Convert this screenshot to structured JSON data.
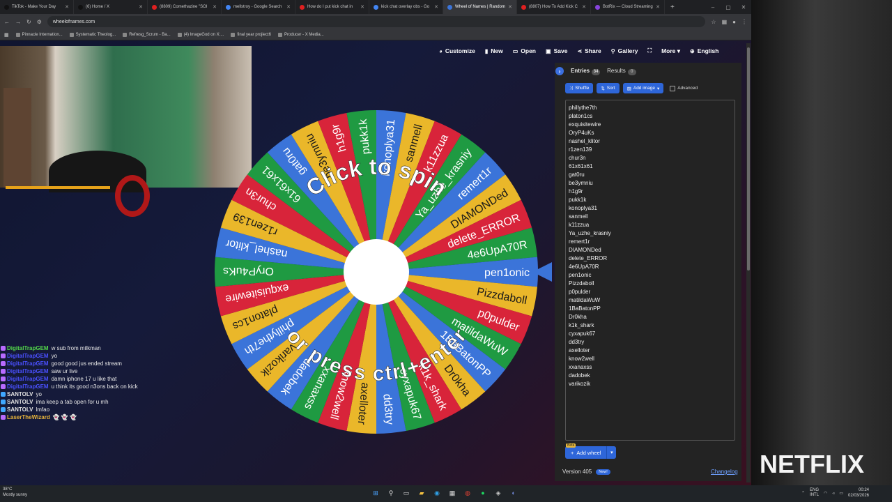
{
  "browser": {
    "tabs": [
      {
        "title": "TikTok - Make Your Day",
        "color": "#111111"
      },
      {
        "title": "(6) Home / X",
        "color": "#111111"
      },
      {
        "title": "(8809) Comethazine \"SOI",
        "color": "#e02020"
      },
      {
        "title": "mellstroy - Google Search",
        "color": "#4285f4"
      },
      {
        "title": "How do I put kick chat in",
        "color": "#e02020"
      },
      {
        "title": "kick chat overlay obs - Go",
        "color": "#4285f4"
      },
      {
        "title": "Wheel of Names | Random",
        "color": "#3b74d9",
        "active": true
      },
      {
        "title": "(8807) How To Add Kick C",
        "color": "#e02020"
      },
      {
        "title": "BotRix — Cloud Streaming",
        "color": "#8844dd"
      }
    ],
    "new_tab": "+",
    "url": "wheelofnames.com",
    "bookmarks": [
      "Pinnacle Internation...",
      "Systematic Theolog...",
      "Refresg_Scrum - Ba...",
      "(4) ImageGod on X:...",
      "final year projiect6",
      "Producer - X Media..."
    ]
  },
  "topnav": {
    "items": [
      {
        "icon": "palette-icon",
        "glyph": "◕",
        "label": "Customize"
      },
      {
        "icon": "new-file-icon",
        "glyph": "▮",
        "label": "New"
      },
      {
        "icon": "folder-icon",
        "glyph": "▭",
        "label": "Open"
      },
      {
        "icon": "save-icon",
        "glyph": "▣",
        "label": "Save"
      },
      {
        "icon": "share-icon",
        "glyph": "⋖",
        "label": "Share"
      },
      {
        "icon": "search-icon",
        "glyph": "⚲",
        "label": "Gallery"
      },
      {
        "icon": "fullscreen-icon",
        "glyph": "⛶",
        "label": ""
      },
      {
        "icon": "more-icon",
        "glyph": "",
        "label": "More ▾"
      },
      {
        "icon": "globe-icon",
        "glyph": "⊕",
        "label": "English"
      }
    ]
  },
  "wheel": {
    "center_top": "Click to spin",
    "center_bottom": "or press ctrl+enter",
    "colors": [
      "#3b74d9",
      "#eab72a",
      "#d8243a",
      "#1f9a42"
    ]
  },
  "panel": {
    "entries_tab": "Entries",
    "entries_count": "34",
    "results_tab": "Results",
    "results_count": "0",
    "shuffle": "Shuffle",
    "sort": "Sort",
    "add_image": "Add image",
    "advanced": "Advanced",
    "entries": [
      "phillythe7th",
      "platon1cs",
      "exquisitewire",
      "OryP4uKs",
      "nashel_klitor",
      "r1zen139",
      "chur3n",
      "61x61x61",
      "gat0ru",
      "be3ymniu",
      "h1g9r",
      "pukk1k",
      "konoplya31",
      "sanmell",
      "k11zzua",
      "Ya_uzhe_krasniy",
      "remert1r",
      "DIAMONDed",
      "delete_ERROR",
      "4e6UpA70R",
      "pen1onic",
      "Pizzdaboll",
      "p0pulder",
      "matildaWuW",
      "1BaBatonPP",
      "Dr0kha",
      "k1k_shark",
      "cyxapuk67",
      "dd3try",
      "axelloter",
      "know2well",
      "xxanaxss",
      "dadobek",
      "varikozik"
    ],
    "add_wheel": "Add wheel",
    "beta": "Beta",
    "version": "Version 405",
    "new_badge": "New!",
    "changelog": "Changelog"
  },
  "chat": [
    {
      "user": "DigitalTrapGEM",
      "color": "#53d84a",
      "text": "w sub from milkman",
      "badge": "sub"
    },
    {
      "user": "DigitalTrapGEM",
      "color": "#4a50ff",
      "text": "yo",
      "badge": "sub"
    },
    {
      "user": "DigitalTrapGEM",
      "color": "#4a50ff",
      "text": "good good jus ended stream",
      "badge": "sub"
    },
    {
      "user": "DigitalTrapGEM",
      "color": "#4a50ff",
      "text": "saw ur live",
      "badge": "sub"
    },
    {
      "user": "DigitalTrapGEM",
      "color": "#4a50ff",
      "text": "damn iphone 17 u like that",
      "badge": "sub"
    },
    {
      "user": "DigitalTrapGEM",
      "color": "#4a50ff",
      "text": "u think its good n3ons back on kick",
      "badge": "sub"
    },
    {
      "user": "SANTOLV",
      "color": "#e0e0e0",
      "text": "yo",
      "badge": "mod"
    },
    {
      "user": "SANTOLV",
      "color": "#e0e0e0",
      "text": "ima keep a tab open for u mh",
      "badge": "mod"
    },
    {
      "user": "SANTOLV",
      "color": "#e0e0e0",
      "text": "lmfao",
      "badge": "mod"
    },
    {
      "user": "LaserTheWizard",
      "color": "#e6b33a",
      "text": "👻 👻 👻",
      "badge": "sub"
    }
  ],
  "overlay": {
    "brand": "NETFLIX"
  },
  "taskbar": {
    "weather_temp": "38°C",
    "weather_text": "Mostly sunny",
    "lang1": "ENG",
    "lang2": "INTL",
    "time": "00:24",
    "date": "02/03/2026",
    "apps": [
      {
        "name": "start-icon",
        "glyph": "⊞",
        "color": "#4aa3ff"
      },
      {
        "name": "search-icon",
        "glyph": "⚲",
        "color": "#dddddd"
      },
      {
        "name": "task-view-icon",
        "glyph": "▭",
        "color": "#dddddd"
      },
      {
        "name": "file-explorer-icon",
        "glyph": "▰",
        "color": "#f2c041"
      },
      {
        "name": "edge-icon",
        "glyph": "◉",
        "color": "#2fa0e6"
      },
      {
        "name": "store-icon",
        "glyph": "▦",
        "color": "#dddddd"
      },
      {
        "name": "chrome-icon",
        "glyph": "◍",
        "color": "#e34133"
      },
      {
        "name": "spotify-icon",
        "glyph": "●",
        "color": "#1ed760"
      },
      {
        "name": "app-icon",
        "glyph": "◈",
        "color": "#cccccc"
      },
      {
        "name": "discord-icon",
        "glyph": "◐",
        "color": "#7289da"
      }
    ]
  }
}
